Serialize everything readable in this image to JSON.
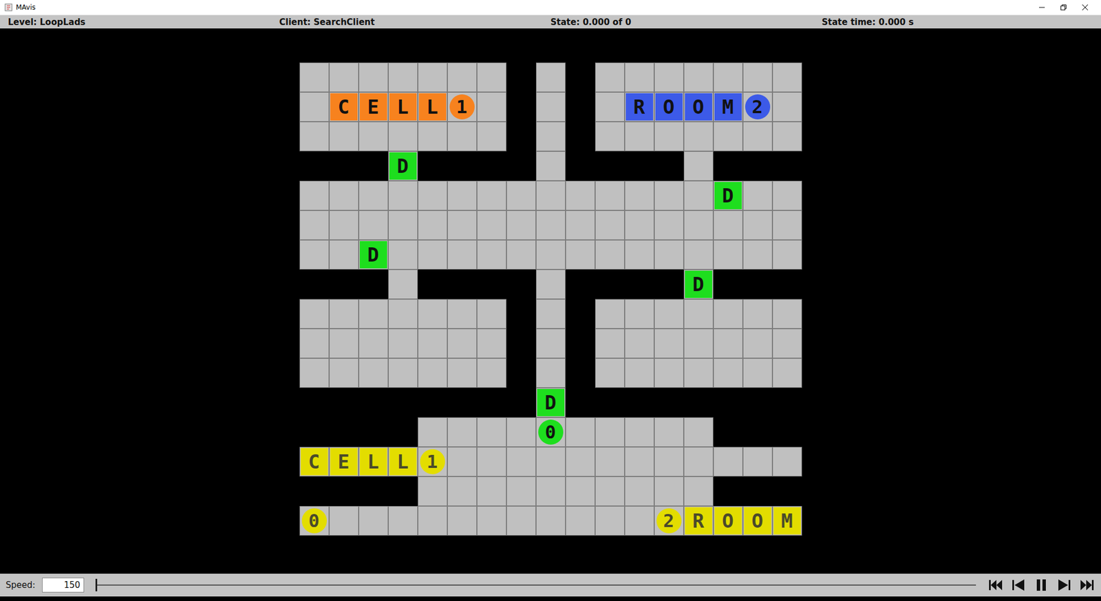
{
  "window": {
    "title": "MAvis"
  },
  "info_bar": [
    {
      "label": "Level: LoopLads"
    },
    {
      "label": "Client: SearchClient"
    },
    {
      "label": "State: 0.000 of 0"
    },
    {
      "label": "State time: 0.000 s"
    }
  ],
  "board": {
    "map": [
      ".......#.#.......",
      ".......#.#.......",
      ".......#.#.......",
      "###.####.####.###",
      ".................",
      ".................",
      ".................",
      "###.####.####.###",
      ".......#.#.......",
      ".......#.#.......",
      ".......#.#.......",
      "########.########",
      "####..........###",
      ".................",
      "####..........###",
      "................."
    ],
    "objects": [
      {
        "kind": "box",
        "row": 1,
        "col": 1,
        "label": "C",
        "color": "#f7821e"
      },
      {
        "kind": "box",
        "row": 1,
        "col": 2,
        "label": "E",
        "color": "#f7821e"
      },
      {
        "kind": "box",
        "row": 1,
        "col": 3,
        "label": "L",
        "color": "#f7821e"
      },
      {
        "kind": "box",
        "row": 1,
        "col": 4,
        "label": "L",
        "color": "#f7821e"
      },
      {
        "kind": "agent",
        "row": 1,
        "col": 5,
        "label": "1",
        "color": "#f7821e"
      },
      {
        "kind": "box",
        "row": 1,
        "col": 11,
        "label": "R",
        "color": "#3c5ae8"
      },
      {
        "kind": "box",
        "row": 1,
        "col": 12,
        "label": "O",
        "color": "#3c5ae8"
      },
      {
        "kind": "box",
        "row": 1,
        "col": 13,
        "label": "O",
        "color": "#3c5ae8"
      },
      {
        "kind": "box",
        "row": 1,
        "col": 14,
        "label": "M",
        "color": "#3c5ae8"
      },
      {
        "kind": "agent",
        "row": 1,
        "col": 15,
        "label": "2",
        "color": "#3c5ae8"
      },
      {
        "kind": "box",
        "row": 3,
        "col": 3,
        "label": "D",
        "color": "#1ede1e"
      },
      {
        "kind": "box",
        "row": 4,
        "col": 14,
        "label": "D",
        "color": "#1ede1e"
      },
      {
        "kind": "box",
        "row": 6,
        "col": 2,
        "label": "D",
        "color": "#1ede1e"
      },
      {
        "kind": "box",
        "row": 7,
        "col": 13,
        "label": "D",
        "color": "#1ede1e"
      },
      {
        "kind": "box",
        "row": 11,
        "col": 8,
        "label": "D",
        "color": "#1ede1e"
      },
      {
        "kind": "agent",
        "row": 12,
        "col": 8,
        "label": "0",
        "color": "#1ede1e"
      },
      {
        "kind": "goal-box",
        "row": 13,
        "col": 0,
        "label": "C",
        "color": "#e3dd00"
      },
      {
        "kind": "goal-box",
        "row": 13,
        "col": 1,
        "label": "E",
        "color": "#e3dd00"
      },
      {
        "kind": "goal-box",
        "row": 13,
        "col": 2,
        "label": "L",
        "color": "#e3dd00"
      },
      {
        "kind": "goal-box",
        "row": 13,
        "col": 3,
        "label": "L",
        "color": "#e3dd00"
      },
      {
        "kind": "goal-agent",
        "row": 13,
        "col": 4,
        "label": "1",
        "color": "#e3dd00"
      },
      {
        "kind": "goal-agent",
        "row": 15,
        "col": 0,
        "label": "0",
        "color": "#e3dd00"
      },
      {
        "kind": "goal-agent",
        "row": 15,
        "col": 12,
        "label": "2",
        "color": "#e3dd00"
      },
      {
        "kind": "goal-box",
        "row": 15,
        "col": 13,
        "label": "R",
        "color": "#e3dd00"
      },
      {
        "kind": "goal-box",
        "row": 15,
        "col": 14,
        "label": "O",
        "color": "#e3dd00"
      },
      {
        "kind": "goal-box",
        "row": 15,
        "col": 15,
        "label": "O",
        "color": "#e3dd00"
      },
      {
        "kind": "goal-box",
        "row": 15,
        "col": 16,
        "label": "M",
        "color": "#e3dd00"
      }
    ]
  },
  "controls": {
    "speed_label": "Speed:",
    "speed_value": "150",
    "timeline": {
      "level": 0
    }
  }
}
